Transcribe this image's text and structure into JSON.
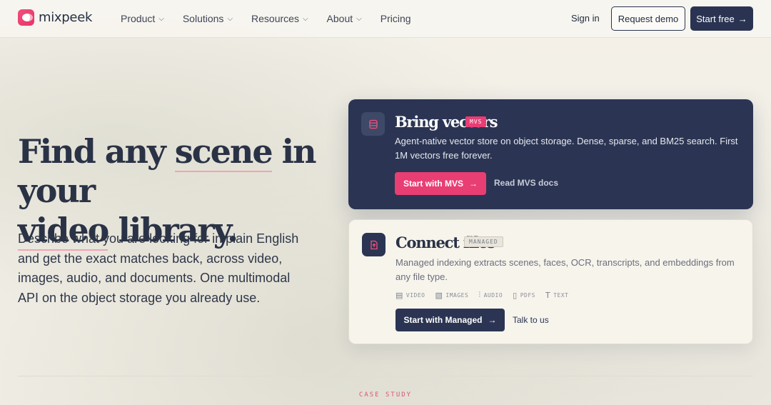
{
  "brand": {
    "name": "mixpeek"
  },
  "nav": {
    "links": [
      {
        "label": "Product",
        "has_menu": true
      },
      {
        "label": "Solutions",
        "has_menu": true
      },
      {
        "label": "Resources",
        "has_menu": true
      },
      {
        "label": "About",
        "has_menu": true
      },
      {
        "label": "Pricing",
        "has_menu": false
      }
    ],
    "signin": "Sign in",
    "request_demo": "Request demo",
    "start_free": "Start free",
    "start_free_arrow": "→"
  },
  "hero": {
    "title_part1": "Find any ",
    "title_scene": "scene",
    "title_part2": " in your ",
    "title_video": "video",
    "title_part3": " library.",
    "description": "Describe what you are looking for in plain English and get the exact matches back, across video, images, audio, and documents. One multimodal API on the object storage you already use."
  },
  "cards": {
    "mvs": {
      "title": "Bring vectors",
      "tag": "MVS",
      "description": "Agent-native vector store on object storage. Dense, sparse, and BM25 search. First 1M vectors free forever.",
      "primary_button": "Start with MVS",
      "arrow": "→",
      "secondary_link": "Read MVS docs"
    },
    "managed": {
      "title": "Connect files",
      "tag": "MANAGED",
      "description": "Managed indexing extracts scenes, faces, OCR, transcripts, and embeddings from any file type.",
      "filetypes": [
        {
          "icon": "film-icon",
          "label": "VIDEO"
        },
        {
          "icon": "image-icon",
          "label": "IMAGES"
        },
        {
          "icon": "waveform-icon",
          "label": "AUDIO"
        },
        {
          "icon": "document-icon",
          "label": "PDFS"
        },
        {
          "icon": "text-icon",
          "label": "TEXT"
        }
      ],
      "primary_button": "Start with Managed",
      "arrow": "→",
      "secondary_link": "Talk to us"
    }
  },
  "footer_section": {
    "label": "CASE STUDY"
  },
  "colors": {
    "accent_pink": "#e83e74",
    "navy": "#2b3553",
    "background": "#f5f2ea"
  }
}
